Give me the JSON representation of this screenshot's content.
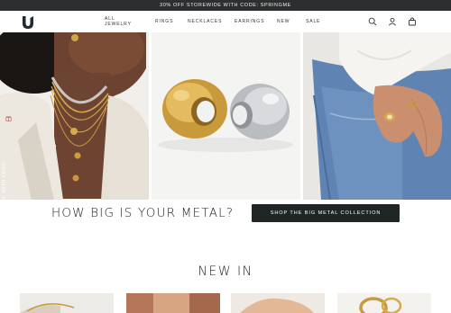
{
  "promo": {
    "text": "30% OFF STOREWIDE WITH CODE: SPRINGME"
  },
  "header": {
    "logo_icon": "brand-monogram-icon",
    "nav": [
      {
        "label": "ALL JEWELRY"
      },
      {
        "label": "RINGS"
      },
      {
        "label": "NECKLACES"
      },
      {
        "label": "EARRINGS"
      },
      {
        "label": "NEW"
      },
      {
        "label": "SALE"
      }
    ],
    "icons": [
      "search-icon",
      "account-icon",
      "bag-icon"
    ]
  },
  "side_tab": {
    "text": "GET 10% OFF WITH EMAIL"
  },
  "metal_section": {
    "heading": "HOW BIG IS YOUR METAL?",
    "cta_label": "SHOP THE BIG METAL COLLECTION"
  },
  "new_in": {
    "heading": "NEW IN"
  },
  "colors": {
    "promo_bg": "#2b2f2f",
    "button_bg": "#1f2424",
    "text": "#222222",
    "gold": "#c99a3b",
    "silver": "#b9bcc0"
  }
}
